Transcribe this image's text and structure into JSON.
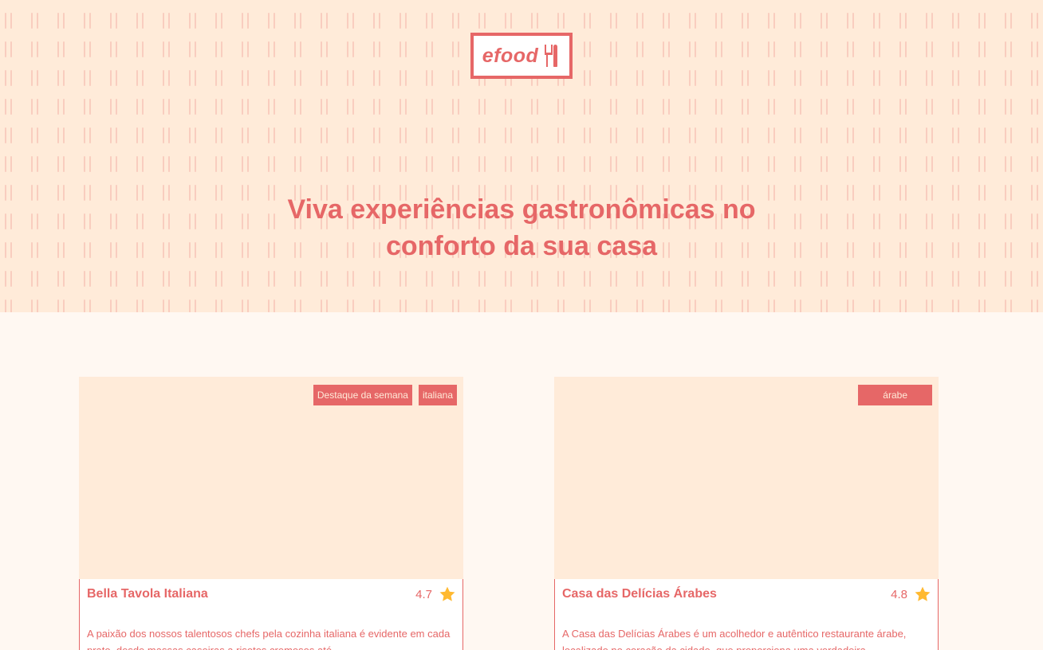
{
  "header": {
    "logo_text": "efood",
    "headline": "Viva experiências gastronômicas no conforto da sua casa"
  },
  "restaurants": [
    {
      "name": "Bella Tavola Italiana",
      "rating": "4.7",
      "tags": [
        "Destaque da semana",
        "italiana"
      ],
      "description": "A paixão dos nossos talentosos chefs pela cozinha italiana é evidente em cada prato, desde massas caseiras a risotos cremosos até"
    },
    {
      "name": "Casa das Delícias Árabes",
      "rating": "4.8",
      "tags": [
        "árabe"
      ],
      "description": "A Casa das Delícias Árabes é um acolhedor e autêntico restaurante árabe, localizado no coração da cidade, que proporciona uma verdadeira"
    }
  ],
  "colors": {
    "primary": "#E66767",
    "hero_background": "#FFEBD9",
    "page_background": "#FFF8F2",
    "star": "#FFB930"
  },
  "icons": [
    "cutlery-icon",
    "star-icon"
  ]
}
